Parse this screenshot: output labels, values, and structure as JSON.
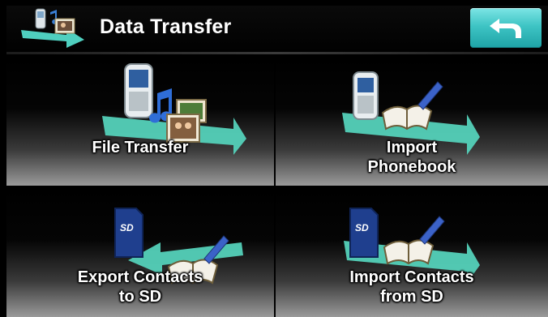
{
  "header": {
    "title": "Data Transfer",
    "icon": "data-transfer-icon",
    "back_icon": "back-arrow-icon"
  },
  "tiles": [
    {
      "label_lines": [
        "File Transfer"
      ],
      "icon": "file-transfer-icon"
    },
    {
      "label_lines": [
        "Import",
        "Phonebook"
      ],
      "icon": "import-phonebook-icon"
    },
    {
      "label_lines": [
        "Export Contacts",
        "to SD"
      ],
      "icon": "export-contacts-sd-icon"
    },
    {
      "label_lines": [
        "Import Contacts",
        "from SD"
      ],
      "icon": "import-contacts-sd-icon"
    }
  ],
  "colors": {
    "accent_teal": "#3ec4c4",
    "arrow_teal": "#5fd6c4",
    "background": "#000000"
  }
}
